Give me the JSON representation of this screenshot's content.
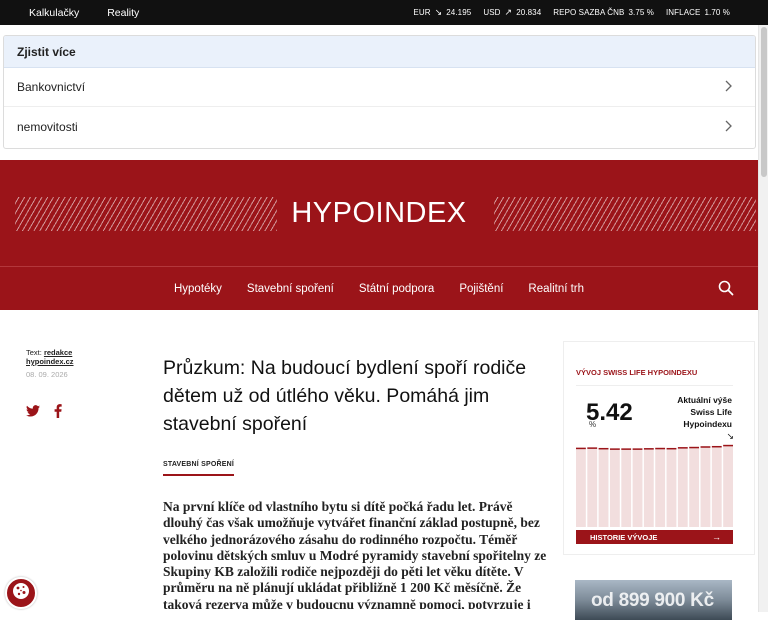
{
  "topbar": {
    "links": [
      "Kalkulačky",
      "Reality"
    ],
    "indicators": [
      {
        "label": "EUR",
        "arrow": "↘",
        "value": "24.195"
      },
      {
        "label": "USD",
        "arrow": "↗",
        "value": "20.834"
      },
      {
        "label": "REPO SAZBA ČNB",
        "arrow": "",
        "value": "3.75 %"
      },
      {
        "label": "INFLACE",
        "arrow": "",
        "value": "1.70 %"
      }
    ]
  },
  "ad": {
    "title": "Zjistit více",
    "rows": [
      "Bankovnictví",
      "nemovitosti"
    ]
  },
  "brand": {
    "logo": "HYPOINDEX",
    "colors": {
      "primary": "#9b1419"
    }
  },
  "nav": {
    "items": [
      "Hypotéky",
      "Stavební spoření",
      "Státní podpora",
      "Pojištění",
      "Realitní trh"
    ]
  },
  "article": {
    "author_prefix": "Text:",
    "author_link_line1": "redakce",
    "author_link_line2": "hypoindex.cz",
    "date": "08. 09. 2026",
    "title": "Průzkum: Na budoucí bydlení spoří rodiče dětem už od útlého věku. Pomáhá jim stavební spoření",
    "tag": "STAVEBNÍ SPOŘENÍ",
    "body": "Na první klíče od vlastního bytu si dítě počká řadu let. Právě dlouhý čas však umožňuje vytvářet finanční základ postupně, bez velkého jednorázového zásahu do rodinného rozpočtu. Téměř polovinu dětských smluv u Modré pyramidy stavební spořitelny ze Skupiny KB založili rodiče nejpozději do pěti let věku dítěte. V průměru na ně plánují ukládat přibližně 1 200 Kč měsíčně. Že taková rezerva může v budoucnu významně pomoci, potvrzuje i praxe."
  },
  "widget": {
    "title": "VÝVOJ SWISS LIFE HYPOINDEXU",
    "value": "5.42",
    "unit": "%",
    "label": "Aktuální výše Swiss Life Hypoindexu",
    "trend": "↘",
    "history_label": "HISTORIE VÝVOJE",
    "history_arrow": "→"
  },
  "chart_data": {
    "type": "bar",
    "values": [
      5.6,
      5.62,
      5.58,
      5.55,
      5.55,
      5.55,
      5.57,
      5.59,
      5.58,
      5.64,
      5.66,
      5.7,
      5.72,
      5.8
    ],
    "ylim": [
      0,
      6
    ],
    "bar_color": "#f2dede",
    "bar_top_color": "#9b1419"
  },
  "promo": {
    "text": "od 899 900 Kč"
  }
}
